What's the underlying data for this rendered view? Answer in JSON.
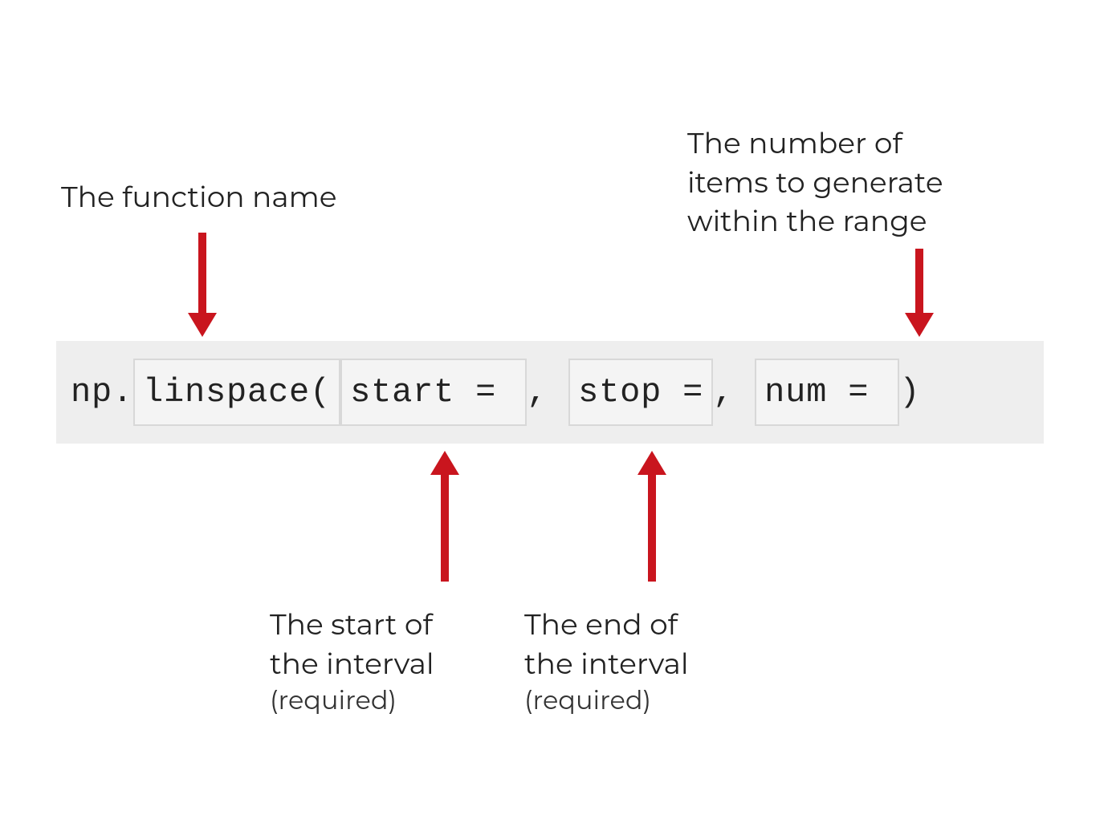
{
  "annotations": {
    "function_name": "The function name",
    "num_line1": "The number of",
    "num_line2": "items to generate",
    "num_line3": "within the range",
    "start_line1": "The start of",
    "start_line2": "the interval",
    "start_req": "(required)",
    "end_line1": "The end of",
    "end_line2": "the interval",
    "end_req": "(required)"
  },
  "code": {
    "prefix": "np.",
    "func_box": "linspace(",
    "start_box": "start = ",
    "sep1": ", ",
    "stop_box": "stop =",
    "sep2": ", ",
    "num_box": "num = ",
    "suffix": ")"
  },
  "colors": {
    "arrow": "#c9151e",
    "strip_bg": "#eeeeee",
    "box_border": "#d8d8d8"
  }
}
